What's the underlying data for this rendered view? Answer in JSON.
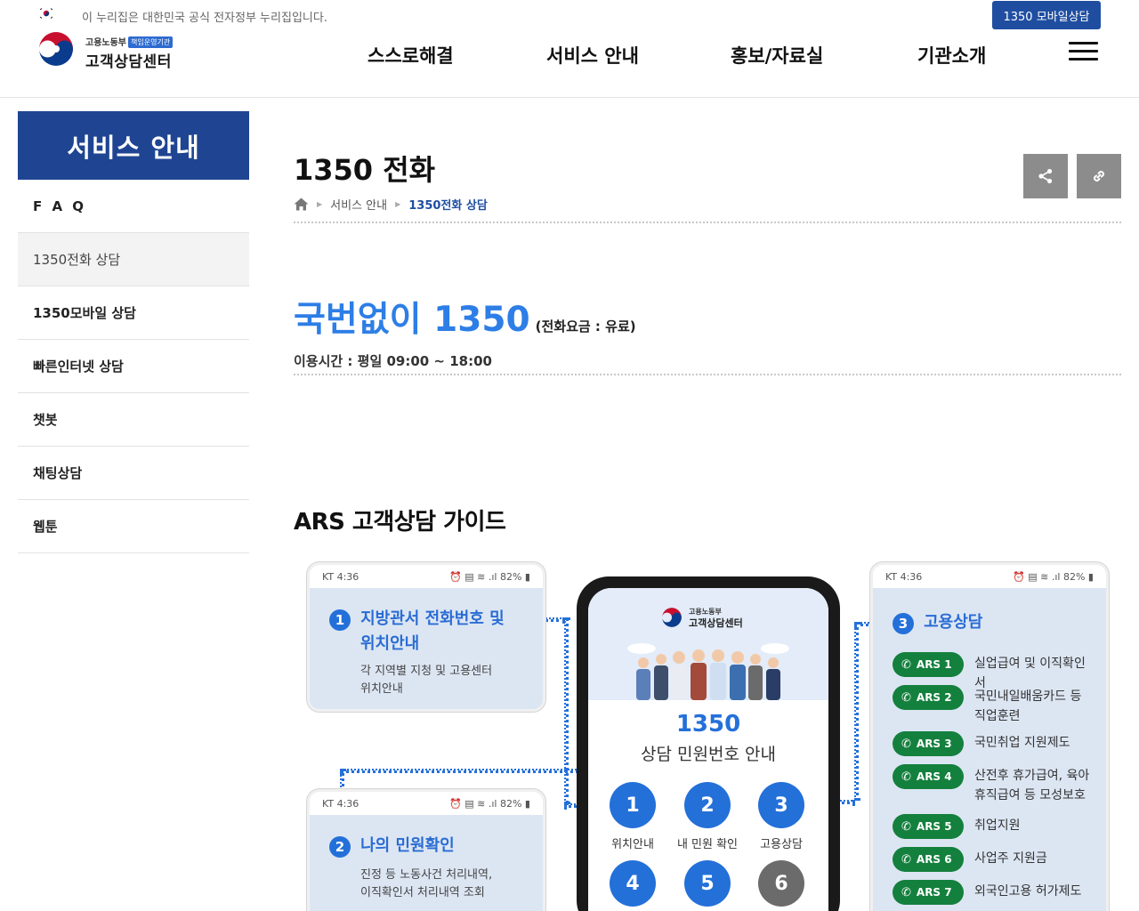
{
  "gov_banner": {
    "text": "이 누리집은 대한민국 공식 전자정부 누리집입니다.",
    "mobile_button": "1350 모바일상담"
  },
  "logo": {
    "ministry": "고용노동부",
    "badge": "책임운영기관",
    "name": "고객상담센터"
  },
  "nav": [
    "스스로해결",
    "서비스 안내",
    "홍보/자료실",
    "기관소개"
  ],
  "sidebar": {
    "title": "서비스 안내",
    "items": [
      {
        "label": "F A Q"
      },
      {
        "label": "1350전화 상담"
      },
      {
        "label": "1350모바일 상담"
      },
      {
        "label": "빠른인터넷 상담"
      },
      {
        "label": "챗봇"
      },
      {
        "label": "채팅상담"
      },
      {
        "label": "웹툰"
      }
    ],
    "active_index": 1
  },
  "page": {
    "title": "1350 전화",
    "breadcrumb": [
      "서비스 안내",
      "1350전화 상담"
    ]
  },
  "headline": {
    "main": "국번없이 1350",
    "sub": "(전화요금 : 유료)",
    "hours": "이용시간 : 평일 09:00 ~ 18:00"
  },
  "ars": {
    "title": "ARS 고객상담 가이드",
    "status_left": "KT 4:36",
    "status_right": "82%",
    "card1": {
      "num": "1",
      "title_line1": "지방관서 전화번호 및",
      "title_line2": "위치안내",
      "desc_line1": "각 지역별 지청 및 고용센터",
      "desc_line2": "위치안내"
    },
    "card2": {
      "num": "2",
      "title": "나의 민원확인",
      "desc_line1": "진정 등 노동사건 처리내역,",
      "desc_line2": "이직확인서 처리내역 조회"
    },
    "card3": {
      "num": "3",
      "title": "고용상담"
    },
    "phone": {
      "ministry": "고용노동부",
      "center": "고객상담센터",
      "number": "1350",
      "subtitle": "상담 민원번호 안내",
      "keys": [
        {
          "num": "1",
          "label": "위치안내"
        },
        {
          "num": "2",
          "label": "내 민원 확인"
        },
        {
          "num": "3",
          "label": "고용상담"
        },
        {
          "num": "4",
          "label": ""
        },
        {
          "num": "5",
          "label": ""
        },
        {
          "num": "6",
          "label": ""
        }
      ]
    },
    "items": [
      {
        "code": "ARS 1",
        "text": "실업급여 및 이직확인서"
      },
      {
        "code": "ARS 2",
        "text": "국민내일배움카드 등 직업훈련"
      },
      {
        "code": "ARS 3",
        "text": "국민취업 지원제도"
      },
      {
        "code": "ARS 4",
        "text": "산전후 휴가급여, 육아 휴직급여 등 모성보호"
      },
      {
        "code": "ARS 5",
        "text": "취업지원"
      },
      {
        "code": "ARS 6",
        "text": "사업주 지원금"
      },
      {
        "code": "ARS 7",
        "text": "외국인고용 허가제도"
      }
    ],
    "colors": {
      "accent": "#2470d9",
      "ars_pill": "#14803d",
      "card_bg": "#dce6f3"
    }
  },
  "colors": {
    "brand": "#1f4592",
    "mobile_button": "#1f4ea1",
    "headline": "#2d7ee6"
  }
}
